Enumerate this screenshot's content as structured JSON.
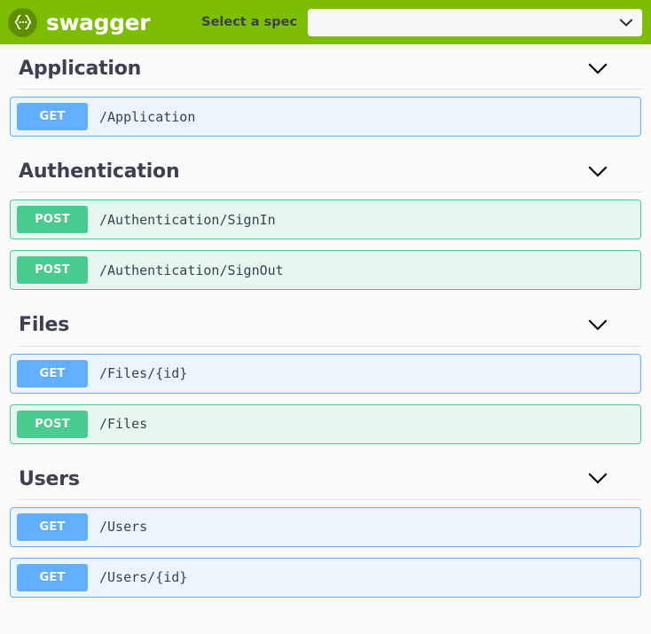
{
  "topbar": {
    "logo_icon": "swagger-braces-icon",
    "logo_text": "swagger",
    "spec_label": "Select a spec",
    "spec_select_value": "",
    "spec_select_placeholder": "",
    "caret_icon": "chevron-down-icon",
    "background_color": "#7dbe04",
    "logo_circle_color": "#5f8f00"
  },
  "colors": {
    "get_badge": "#61affe",
    "get_row_bg": "#ebf3fb",
    "post_badge": "#49cc90",
    "post_row_bg": "#e8f6f0",
    "text_dark": "#3b4151",
    "divider": "#dadfe1",
    "page_bg": "#fafafa"
  },
  "sections": [
    {
      "title": "Application",
      "caret_icon": "chevron-down-icon",
      "operations": [
        {
          "method": "GET",
          "path": "/Application"
        }
      ]
    },
    {
      "title": "Authentication",
      "caret_icon": "chevron-down-icon",
      "operations": [
        {
          "method": "POST",
          "path": "/Authentication/SignIn"
        },
        {
          "method": "POST",
          "path": "/Authentication/SignOut"
        }
      ]
    },
    {
      "title": "Files",
      "caret_icon": "chevron-down-icon",
      "operations": [
        {
          "method": "GET",
          "path": "/Files/{id}"
        },
        {
          "method": "POST",
          "path": "/Files"
        }
      ]
    },
    {
      "title": "Users",
      "caret_icon": "chevron-down-icon",
      "operations": [
        {
          "method": "GET",
          "path": "/Users"
        },
        {
          "method": "GET",
          "path": "/Users/{id}"
        }
      ]
    }
  ]
}
